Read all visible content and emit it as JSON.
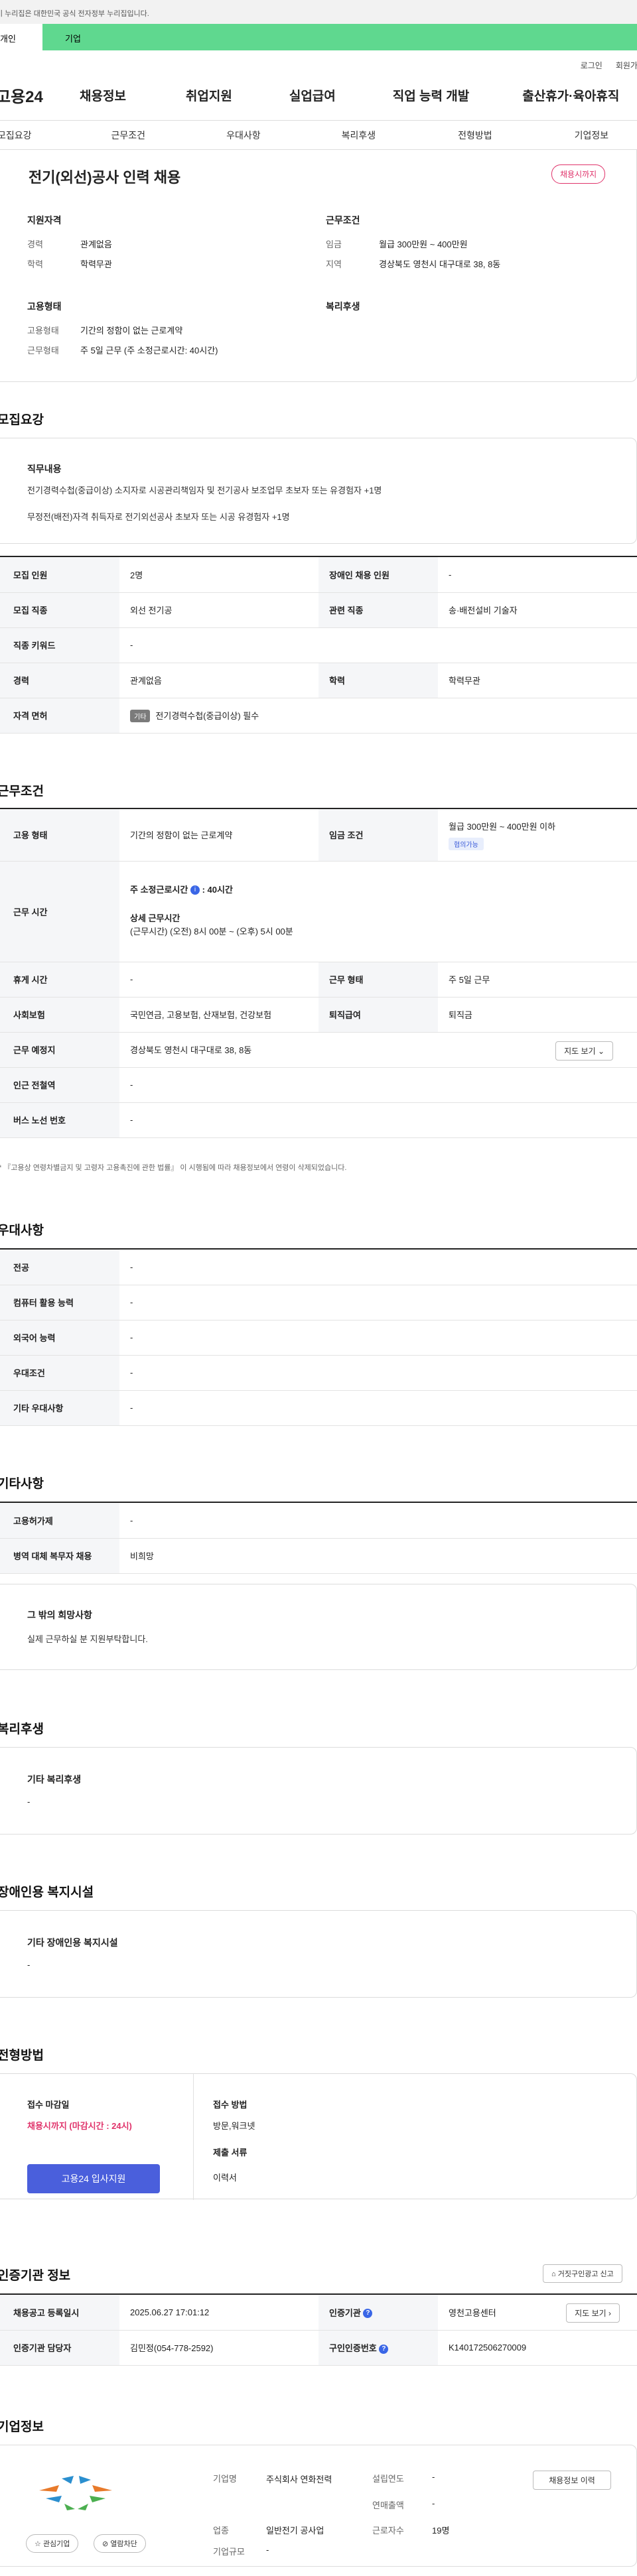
{
  "gov_notice": "이 누리집은 대한민국 공식 전자정부 누리집입니다.",
  "top_tabs": [
    "개인",
    "기업"
  ],
  "util": {
    "login": "로그인",
    "join": "회원가입"
  },
  "gnb": {
    "logo": "고용24",
    "items": [
      "채용정보",
      "취업지원",
      "실업급여",
      "직업 능력 개발",
      "출산휴가·육아휴직"
    ]
  },
  "snb": [
    "모집요강",
    "근무조건",
    "우대사항",
    "복리후생",
    "전형방법",
    "기업정보"
  ],
  "header": {
    "title": "전기(외선)공사 인력 채용",
    "status": "채용시까지",
    "qual": {
      "title": "지원자격",
      "career_l": "경력",
      "career_v": "관계없음",
      "edu_l": "학력",
      "edu_v": "학력무관"
    },
    "cond": {
      "title": "근무조건",
      "wage_l": "임금",
      "wage_v": "월급 300만원 ~ 400만원",
      "region_l": "지역",
      "region_v": "경상북도 영천시 대구대로 38, 8동"
    },
    "emp": {
      "title": "고용형태",
      "type_l": "고용형태",
      "type_v": "기간의 정함이 없는 근로계약",
      "hours_l": "근무형태",
      "hours_v": "주 5일 근무 (주 소정근로시간: 40시간)"
    },
    "welfare": {
      "title": "복리후생"
    }
  },
  "recruit": {
    "title": "모집요강",
    "duty_title": "직무내용",
    "duty_lines": [
      "전기경력수첩(중급이상) 소지자로 시공관리책임자 및 전기공사 보조업무 초보자 또는 유경험자 +1명",
      "무정전(배전)자격 취득자로 전기외선공사 초보자 또는 시공 유경험자 +1명"
    ],
    "rows": [
      [
        "모집 인원",
        "2명",
        "장애인 채용 인원",
        "-"
      ],
      [
        "모집 직종",
        "외선 전기공",
        "관련 직종",
        "송·배전설비 기술자"
      ],
      [
        "직종 키워드",
        "-"
      ],
      [
        "경력",
        "관계없음",
        "학력",
        "학력무관"
      ]
    ],
    "license_l": "자격 면허",
    "license_tag": "기타",
    "license_v": "전기경력수첩(중급이상) 필수"
  },
  "work": {
    "title": "근무조건",
    "type_l": "고용 형태",
    "type_v": "기간의 정함이 없는 근로계약",
    "wage_l": "임금 조건",
    "wage_v": "월급 300만원 ~ 400만원 이하",
    "wage_tag": "협의가능",
    "hours_l": "근무 시간",
    "hours_main": "주 소정근로시간",
    "hours_main_v": ": 40시간",
    "hours_detail_t": "상세 근무시간",
    "hours_detail_v": "(근무시간) (오전) 8시 00분 ~ (오후) 5시 00분",
    "rest_l": "휴게 시간",
    "rest_v": "-",
    "form_l": "근무 형태",
    "form_v": "주 5일 근무",
    "ins_l": "사회보험",
    "ins_v": "국민연금, 고용보험, 산재보험, 건강보험",
    "ret_l": "퇴직급여",
    "ret_v": "퇴직금",
    "loc_l": "근무 예정지",
    "loc_v": "경상북도 영천시 대구대로 38, 8동",
    "map_btn": "지도 보기",
    "sub_l": "인근 전철역",
    "sub_v": "-",
    "bus_l": "버스 노선 번호",
    "bus_v": "-",
    "note": "* 『고용상 연령차별금지 및 고령자 고용촉진에 관한 법률』 이 시행됨에 따라 채용정보에서 연령이 삭제되었습니다."
  },
  "pref": {
    "title": "우대사항",
    "rows": [
      [
        "전공",
        "-"
      ],
      [
        "컴퓨터 활용 능력",
        "-"
      ],
      [
        "외국어 능력",
        "-"
      ],
      [
        "우대조건",
        "-"
      ],
      [
        "기타 우대사항",
        "-"
      ]
    ]
  },
  "etc": {
    "title": "기타사항",
    "rows": [
      [
        "고용허가제",
        "-"
      ],
      [
        "병역 대체 복무자 채용",
        "비희망"
      ]
    ],
    "hope_t": "그 밖의 희망사항",
    "hope_v": "실제 근무하실 분 지원부탁합니다."
  },
  "benefit": {
    "title": "복리후생",
    "sub": "기타 복리후생",
    "v": "-"
  },
  "disab": {
    "title": "장애인용 복지시설",
    "sub": "기타 장애인용 복지시설",
    "v": "-"
  },
  "select": {
    "title": "전형방법",
    "deadline_l": "접수 마감일",
    "deadline_v": "채용시까지 (마감시간 : 24시)",
    "apply_btn": "고용24 입사지원",
    "method_l": "접수 방법",
    "method_v": "방문,워크넷",
    "docs_l": "제출 서류",
    "docs_v": "이력서"
  },
  "agency": {
    "title": "인증기관 정보",
    "report_btn": "거짓구인광고 신고",
    "reg_l": "채용공고 등록일시",
    "reg_v": "2025.06.27 17:01:12",
    "agency_l": "인증기관",
    "agency_v": "영천고용센터",
    "map_btn": "지도 보기",
    "mgr_l": "인증기관 담당자",
    "mgr_v": "김민정(054-778-2592)",
    "cert_l": "구인인증번호",
    "cert_v": "K140172506270009"
  },
  "company": {
    "title": "기업정보",
    "name_l": "기업명",
    "name_v": "주식회사 연화전력",
    "ind_l": "업종",
    "ind_v": "일반전기 공사업",
    "size_l": "기업규모",
    "size_v": "-",
    "year_l": "설립연도",
    "year_v": "-",
    "sales_l": "연매출액",
    "sales_v": "-",
    "emp_l": "근로자수",
    "emp_v": "19명",
    "fav_btn": "관심기업",
    "block_btn": "열람차단",
    "hist_btn": "채용정보 이력"
  },
  "colors": {
    "green": "#5fd88f",
    "accent_blue": "#4a5fdc",
    "red": "#e0336b"
  }
}
